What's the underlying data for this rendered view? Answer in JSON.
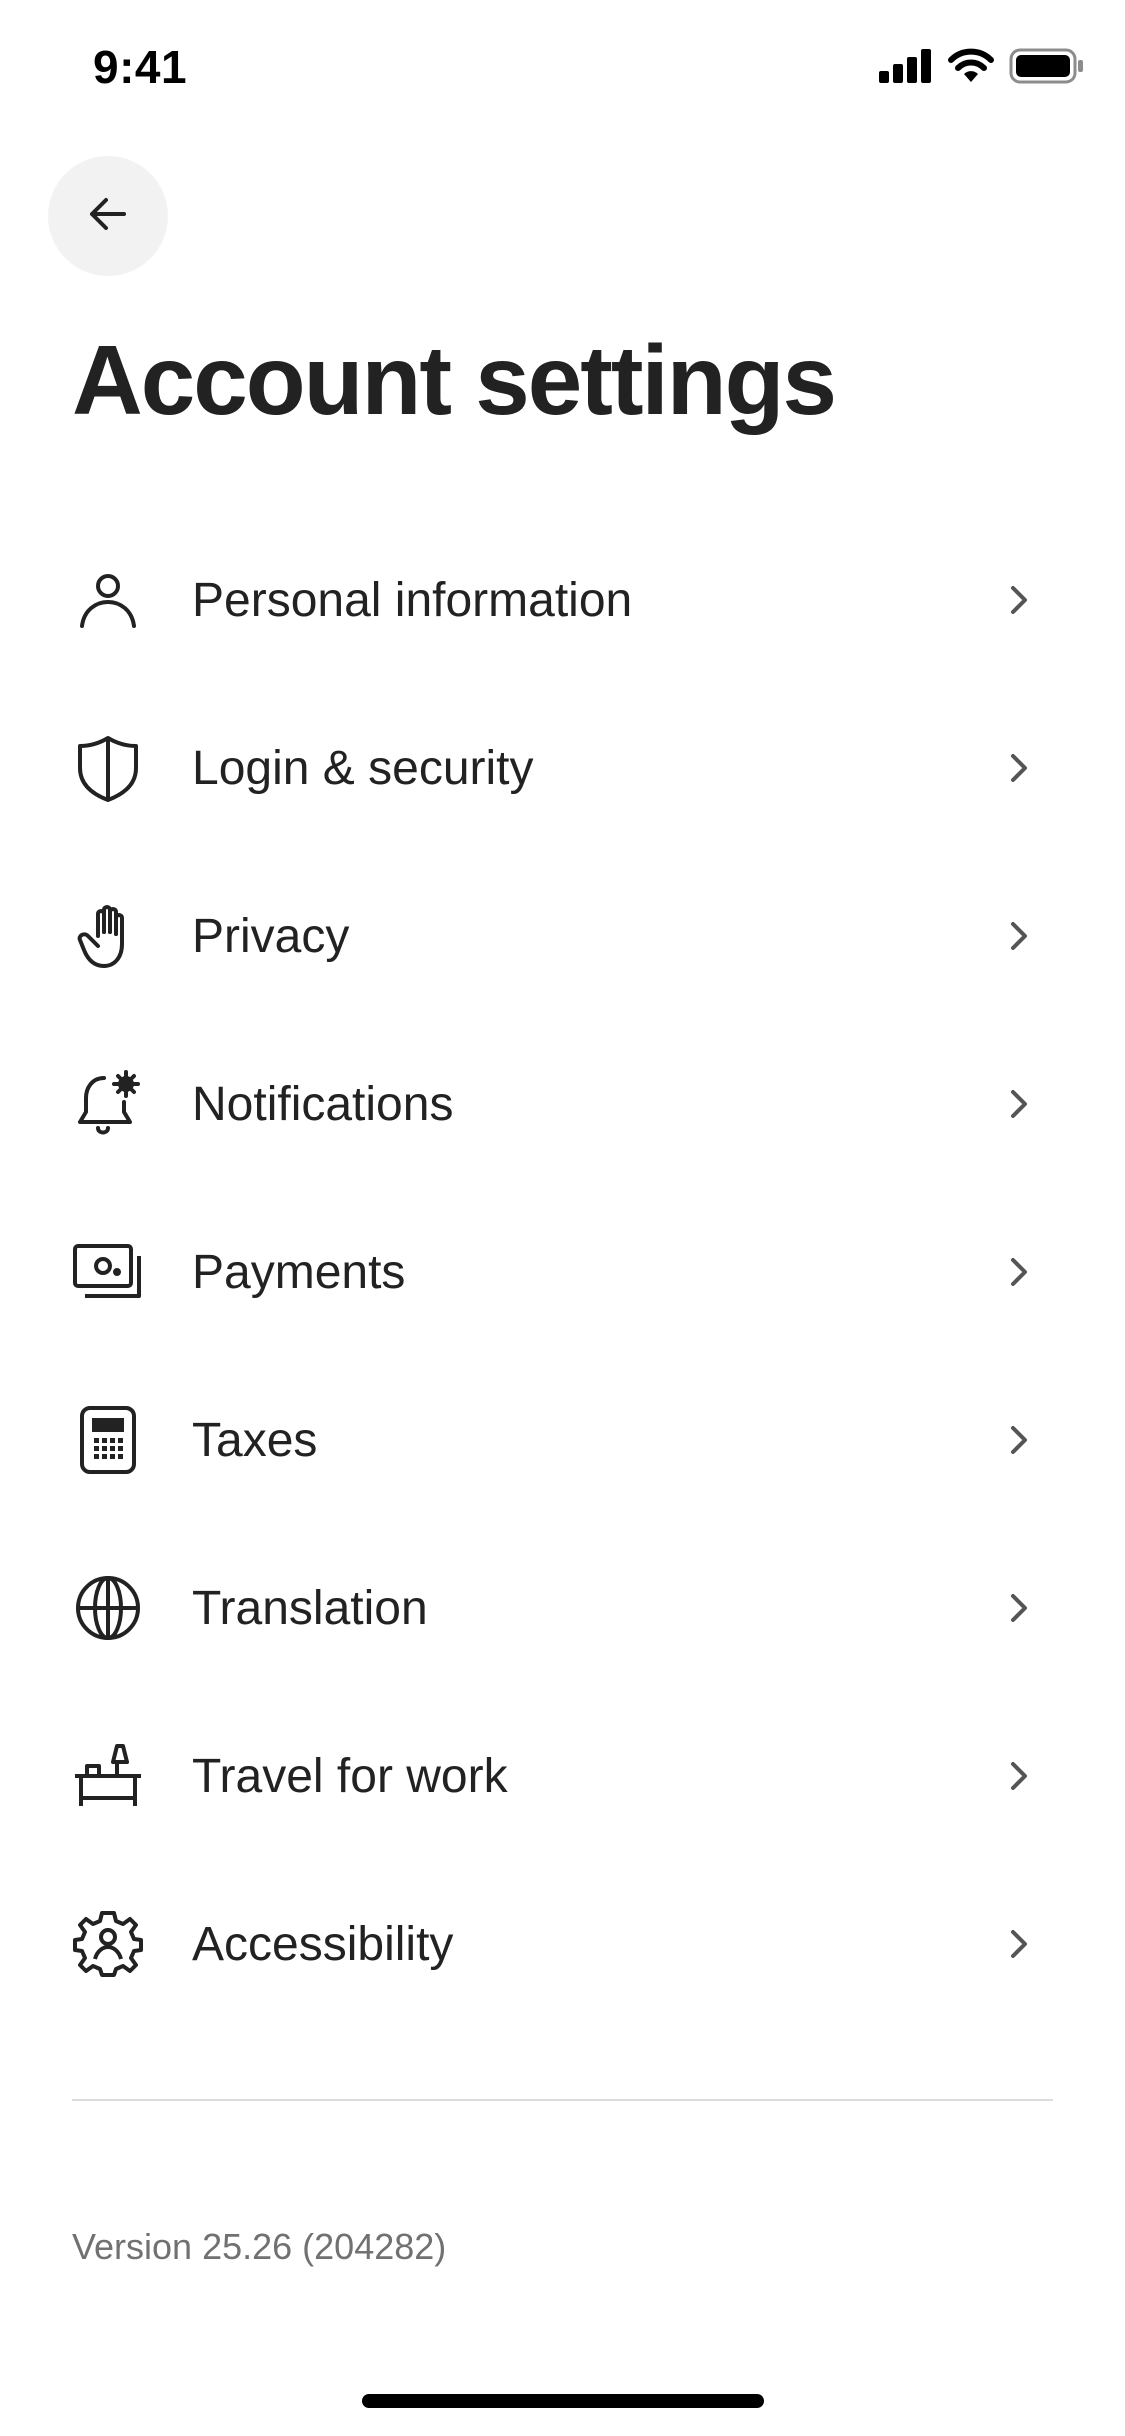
{
  "status_bar": {
    "time": "9:41",
    "icons": [
      "cellular-signal-icon",
      "wifi-icon",
      "battery-icon"
    ]
  },
  "header": {
    "back_icon": "arrow-left-icon",
    "title": "Account settings"
  },
  "settings": {
    "items": [
      {
        "label": "Personal information",
        "icon": "person-icon"
      },
      {
        "label": "Login & security",
        "icon": "shield-icon"
      },
      {
        "label": "Privacy",
        "icon": "hand-icon"
      },
      {
        "label": "Notifications",
        "icon": "bell-gear-icon"
      },
      {
        "label": "Payments",
        "icon": "money-icon"
      },
      {
        "label": "Taxes",
        "icon": "calculator-icon"
      },
      {
        "label": "Translation",
        "icon": "globe-icon"
      },
      {
        "label": "Travel for work",
        "icon": "desk-lamp-icon"
      },
      {
        "label": "Accessibility",
        "icon": "accessibility-gear-icon"
      }
    ]
  },
  "footer": {
    "version": "Version 25.26 (204282)"
  },
  "colors": {
    "text_primary": "#222222",
    "text_secondary": "#717171",
    "divider": "#dddddd",
    "back_button_bg": "#f2f2f2"
  }
}
